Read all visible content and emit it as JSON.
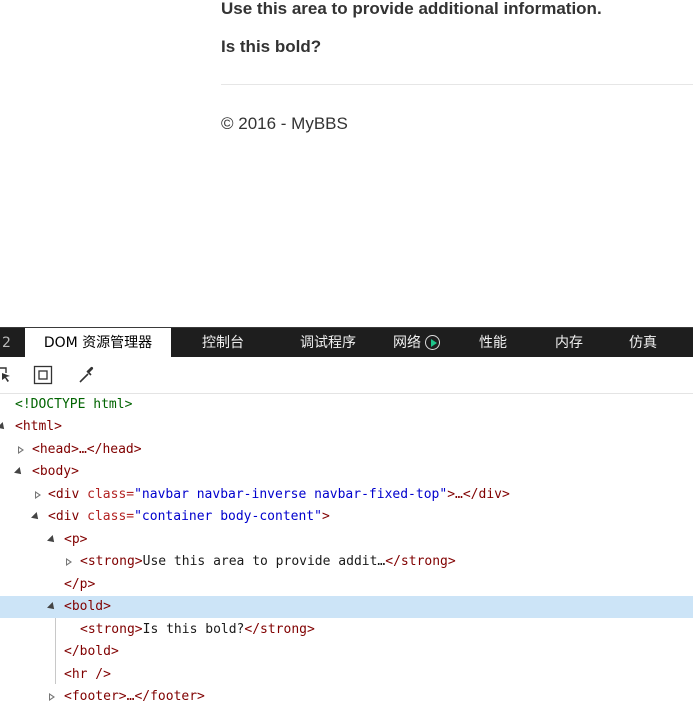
{
  "page": {
    "paragraph_text": "Use this area to provide additional information.",
    "bold_text": "Is this bold?",
    "footer_text": "© 2016 - MyBBS"
  },
  "devtools": {
    "tabs": [
      {
        "label": "2"
      },
      {
        "label": "DOM 资源管理器"
      },
      {
        "label": "控制台"
      },
      {
        "label": "调试程序"
      },
      {
        "label": "网络"
      },
      {
        "label": "性能"
      },
      {
        "label": "内存"
      },
      {
        "label": "仿真"
      }
    ],
    "tree": {
      "doctype": "<!DOCTYPE html>",
      "html_open": "<html>",
      "head": "<head>…</head>",
      "body_open": "<body>",
      "nav_prefix": "<div ",
      "nav_attr": "class=",
      "nav_val": "\"navbar navbar-inverse navbar-fixed-top\"",
      "nav_suffix": ">…</div>",
      "container_prefix": "<div ",
      "container_attr": "class=",
      "container_val": "\"container body-content\"",
      "container_suffix": ">",
      "p_open": "<p>",
      "strong1_open": "<strong>",
      "strong1_text": "Use this area to provide addit…",
      "strong1_close": "</strong>",
      "p_close": "</p>",
      "bold_open": "<bold>",
      "strong2_open": "<strong>",
      "strong2_text": "Is this bold?",
      "strong2_close": "</strong>",
      "bold_close": "</bold>",
      "hr": "<hr />",
      "footer": "<footer>…</footer>"
    }
  },
  "colors": {
    "tabbar_bg": "#1e1e1e",
    "selected_row": "#cce4f7",
    "tag": "#800000",
    "attr_value": "#0000cd"
  }
}
